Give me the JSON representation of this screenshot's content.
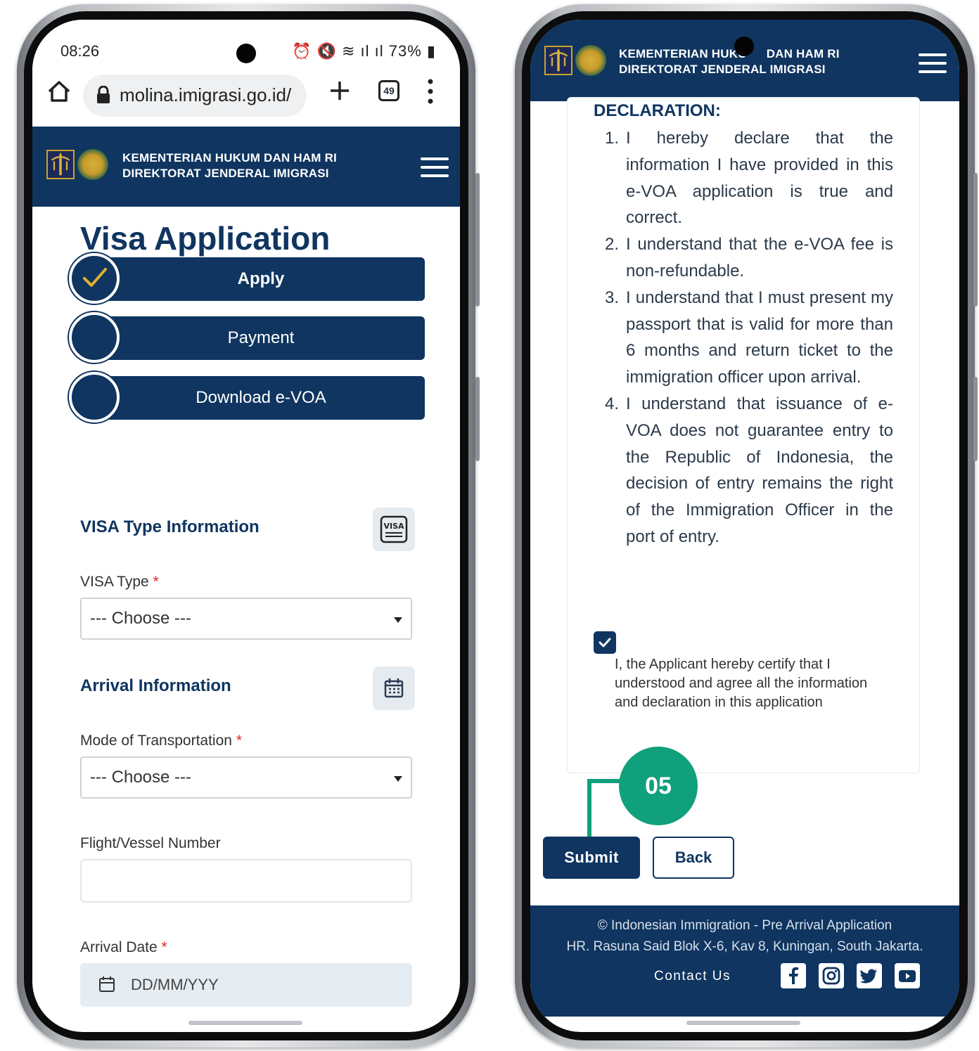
{
  "status_bar": {
    "time": "08:26",
    "battery": "73%"
  },
  "browser": {
    "url": "molina.imigrasi.go.id/",
    "tab_count": "49"
  },
  "header": {
    "line1": "KEMENTERIAN HUKUM DAN HAM RI",
    "line2": "DIREKTORAT JENDERAL IMIGRASI",
    "line1_partial_left": "KEMENTERIAN HUKU",
    "line1_partial_right": "DAN HAM RI"
  },
  "left_page": {
    "title": "Visa Application",
    "steps": [
      {
        "label": "Apply",
        "status": "completed"
      },
      {
        "label": "Payment",
        "status": "pending"
      },
      {
        "label": "Download e-VOA",
        "status": "pending"
      }
    ],
    "visa_section": {
      "title": "VISA Type Information",
      "icon": "visa-icon",
      "icon_text": "VISA"
    },
    "visa_type": {
      "label": "VISA Type",
      "required_mark": "*",
      "value": "--- Choose ---"
    },
    "arrival_section": {
      "title": "Arrival Information",
      "icon": "calendar-icon"
    },
    "transport": {
      "label": "Mode of Transportation",
      "required_mark": "*",
      "value": "--- Choose ---"
    },
    "flight": {
      "label": "Flight/Vessel Number",
      "value": ""
    },
    "arrival_date": {
      "label": "Arrival Date",
      "required_mark": "*",
      "placeholder": "DD/MM/YYY"
    }
  },
  "right_page": {
    "declaration_title": "DECLARATION:",
    "declarations": [
      {
        "num": "1.",
        "text": "I hereby declare that the information I have provided in this e-VOA application is true and correct."
      },
      {
        "num": "2.",
        "text": "I understand that the e-VOA fee is non-refundable."
      },
      {
        "num": "3.",
        "text": "I understand that I must present my passport that is valid for more than 6 months and return ticket to the immigration officer upon arrival."
      },
      {
        "num": "4.",
        "text": "I understand that issuance of e-VOA does not guarantee entry to the Republic of Indonesia, the decision of entry remains the right of the Immigration Officer in the port of entry."
      }
    ],
    "certify_checked": true,
    "certify_text": "I, the Applicant hereby certify that I understood and agree all the information and declaration in this application",
    "submit_label": "Submit",
    "back_label": "Back",
    "footer": {
      "line1": "© Indonesian Immigration - Pre Arrival Application",
      "line2": "HR. Rasuna Said Blok X-6, Kav 8, Kuningan, South Jakarta.",
      "contact": "Contact Us",
      "social": [
        "facebook-icon",
        "instagram-icon",
        "twitter-icon",
        "youtube-icon"
      ]
    }
  },
  "annotation": {
    "step_number": "05"
  },
  "colors": {
    "brand_navy": "#0f3560",
    "accent_green": "#10a07c",
    "check_gold": "#e0b12e",
    "required_red": "#e02a2a"
  }
}
